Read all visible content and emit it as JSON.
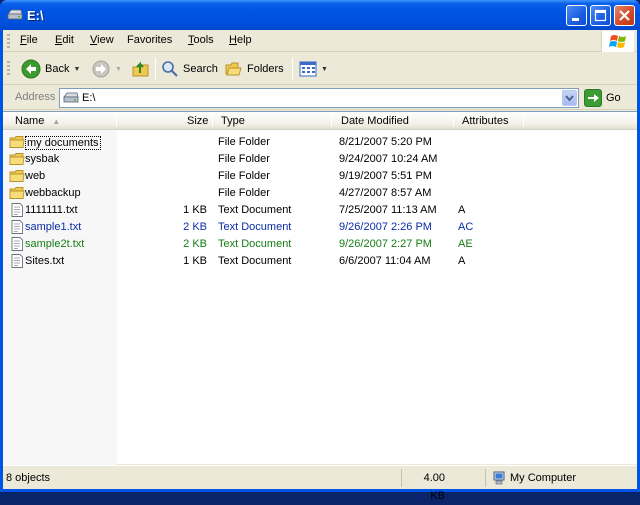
{
  "window": {
    "title": "E:\\"
  },
  "menu": {
    "items": [
      {
        "label": "File",
        "u": "F",
        "rest": "ile"
      },
      {
        "label": "Edit",
        "u": "E",
        "rest": "dit"
      },
      {
        "label": "View",
        "u": "V",
        "rest": "iew"
      },
      {
        "label": "Favorites",
        "u": "",
        "rest": "Favorites"
      },
      {
        "label": "Tools",
        "u": "T",
        "rest": "ools"
      },
      {
        "label": "Help",
        "u": "H",
        "rest": "elp"
      }
    ]
  },
  "toolbar": {
    "back_label": "Back",
    "search_label": "Search",
    "folders_label": "Folders"
  },
  "address": {
    "label": "Address",
    "value": "E:\\",
    "go_label": "Go"
  },
  "columns": {
    "name": "Name",
    "size": "Size",
    "type": "Type",
    "date": "Date Modified",
    "attributes": "Attributes"
  },
  "files": [
    {
      "name": "my documents",
      "size": "",
      "type": "File Folder",
      "date": "8/21/2007 5:20 PM",
      "attr": "",
      "kind": "folder",
      "color": "#000000"
    },
    {
      "name": "sysbak",
      "size": "",
      "type": "File Folder",
      "date": "9/24/2007 10:24 AM",
      "attr": "",
      "kind": "folder",
      "color": "#000000"
    },
    {
      "name": "web",
      "size": "",
      "type": "File Folder",
      "date": "9/19/2007 5:51 PM",
      "attr": "",
      "kind": "folder",
      "color": "#000000"
    },
    {
      "name": "webbackup",
      "size": "",
      "type": "File Folder",
      "date": "4/27/2007 8:57 AM",
      "attr": "",
      "kind": "folder",
      "color": "#000000"
    },
    {
      "name": "1111111.txt",
      "size": "1 KB",
      "type": "Text Document",
      "date": "7/25/2007 11:13 AM",
      "attr": "A",
      "kind": "text",
      "color": "#000000"
    },
    {
      "name": "sample1.txt",
      "size": "2 KB",
      "type": "Text Document",
      "date": "9/26/2007 2:26 PM",
      "attr": "AC",
      "kind": "text",
      "color": "#0a2da8"
    },
    {
      "name": "sample2t.txt",
      "size": "2 KB",
      "type": "Text Document",
      "date": "9/26/2007 2:27 PM",
      "attr": "AE",
      "kind": "text",
      "color": "#157d15"
    },
    {
      "name": "Sites.txt",
      "size": "1 KB",
      "type": "Text Document",
      "date": "6/6/2007 11:04 AM",
      "attr": "A",
      "kind": "text",
      "color": "#000000"
    }
  ],
  "status": {
    "objects": "8 objects",
    "size": "4.00 KB",
    "location": "My Computer"
  }
}
